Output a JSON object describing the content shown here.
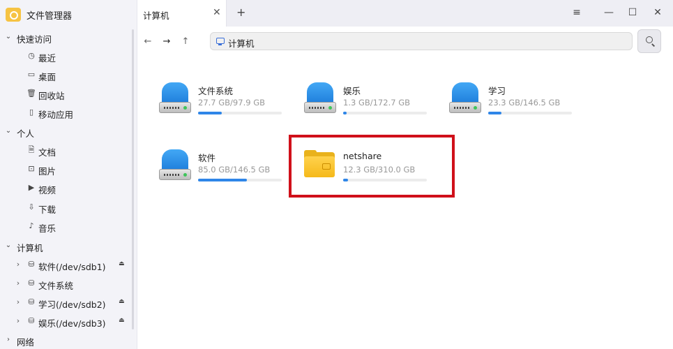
{
  "app": {
    "title": "文件管理器"
  },
  "sidebar": {
    "groups": [
      {
        "label": "快速访问",
        "items": [
          {
            "label": "最近",
            "icon": "clock-icon",
            "glyph": "◷"
          },
          {
            "label": "桌面",
            "icon": "monitor-icon",
            "glyph": "▭"
          },
          {
            "label": "回收站",
            "icon": "trash-icon",
            "glyph": "🗑"
          },
          {
            "label": "移动应用",
            "icon": "phone-icon",
            "glyph": "▯"
          }
        ]
      },
      {
        "label": "个人",
        "items": [
          {
            "label": "文档",
            "icon": "document-icon",
            "glyph": "🗎"
          },
          {
            "label": "图片",
            "icon": "image-icon",
            "glyph": "⊡"
          },
          {
            "label": "视频",
            "icon": "video-icon",
            "glyph": "▶"
          },
          {
            "label": "下载",
            "icon": "download-icon",
            "glyph": "⇩"
          },
          {
            "label": "音乐",
            "icon": "music-icon",
            "glyph": "♪"
          }
        ]
      },
      {
        "label": "计算机",
        "items": [
          {
            "label": "软件(/dev/sdb1)",
            "icon": "drive-icon",
            "glyph": "⛁",
            "eject": true
          },
          {
            "label": "文件系统",
            "icon": "drive-icon",
            "glyph": "⛁",
            "eject": false
          },
          {
            "label": "学习(/dev/sdb2)",
            "icon": "drive-icon",
            "glyph": "⛁",
            "eject": true
          },
          {
            "label": "娱乐(/dev/sdb3)",
            "icon": "drive-icon",
            "glyph": "⛁",
            "eject": true
          }
        ]
      },
      {
        "label": "网络",
        "items": []
      }
    ]
  },
  "tabs": [
    {
      "label": "计算机"
    }
  ],
  "address": {
    "path": "计算机"
  },
  "drives": [
    {
      "name": "文件系统",
      "size": "27.7 GB/97.9 GB",
      "usage": 0.283,
      "kind": "drive"
    },
    {
      "name": "娱乐",
      "size": "1.3 GB/172.7 GB",
      "usage": 0.04,
      "kind": "drive"
    },
    {
      "name": "学习",
      "size": "23.3 GB/146.5 GB",
      "usage": 0.159,
      "kind": "drive"
    },
    {
      "name": "软件",
      "size": "85.0 GB/146.5 GB",
      "usage": 0.58,
      "kind": "drive"
    },
    {
      "name": "netshare",
      "size": "12.3 GB/310.0 GB",
      "usage": 0.06,
      "kind": "folder"
    }
  ],
  "colors": {
    "accent": "#2f86e8",
    "highlight": "#d0101a",
    "sidebar_bg": "#f3f3f8"
  }
}
